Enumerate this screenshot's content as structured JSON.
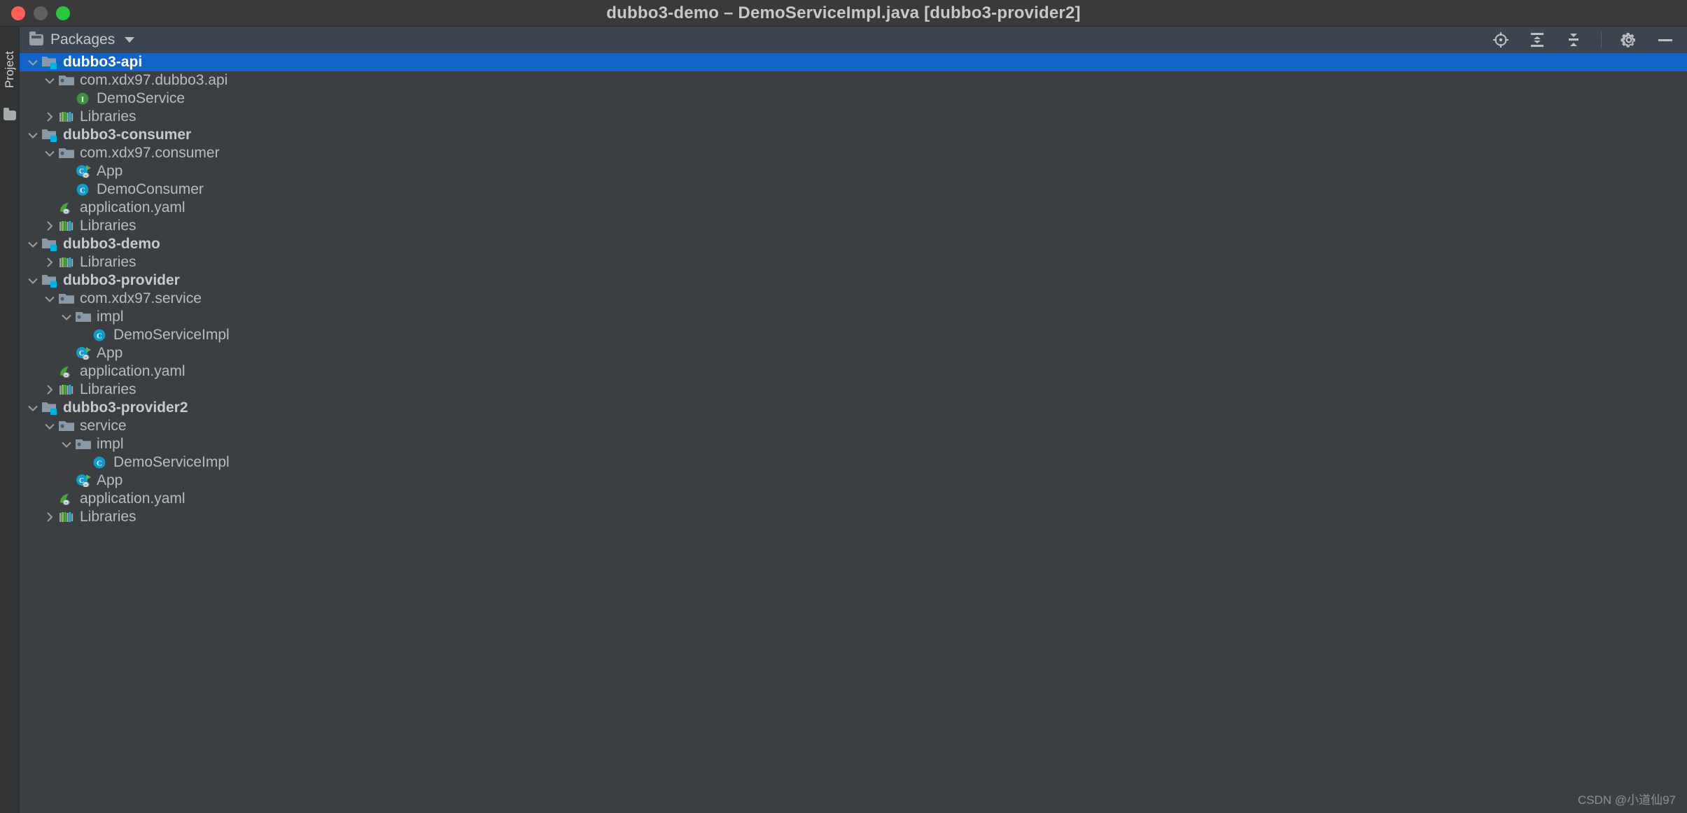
{
  "window": {
    "title": "dubbo3-demo – DemoServiceImpl.java [dubbo3-provider2]",
    "controls": {
      "close": "close-button",
      "minimize": "minimize-button",
      "zoom": "zoom-button"
    }
  },
  "rail": {
    "tab_label": "Project",
    "folder_icon": "folder-icon"
  },
  "toolwindow": {
    "title": "Packages",
    "icons": [
      "locate-icon",
      "expand-all-icon",
      "collapse-all-icon",
      "gear-icon",
      "minimize-icon"
    ]
  },
  "colors": {
    "selection": "#1264c8",
    "background": "#3c3f41",
    "header": "#3d4650",
    "titlebar": "#3a3a3a",
    "text": "#b8bcbf",
    "class_icon": "#0f9bcc",
    "interface_icon": "#3d9140",
    "spring_icon": "#4ba43a",
    "module_badge": "#00b0e0"
  },
  "watermark": "CSDN @小道仙97",
  "tree": {
    "rows": [
      {
        "indent": 0,
        "twisty": "expanded",
        "icon": "module-icon",
        "label": "dubbo3-api",
        "bold": true,
        "selected": true
      },
      {
        "indent": 1,
        "twisty": "expanded",
        "icon": "package-icon",
        "label": "com.xdx97.dubbo3.api",
        "bold": false,
        "selected": false
      },
      {
        "indent": 2,
        "twisty": "none",
        "icon": "interface-icon",
        "label": "DemoService",
        "bold": false,
        "selected": false
      },
      {
        "indent": 1,
        "twisty": "collapsed",
        "icon": "libraries-icon",
        "label": "Libraries",
        "bold": false,
        "selected": false
      },
      {
        "indent": 0,
        "twisty": "expanded",
        "icon": "module-icon",
        "label": "dubbo3-consumer",
        "bold": true,
        "selected": false
      },
      {
        "indent": 1,
        "twisty": "expanded",
        "icon": "package-icon",
        "label": "com.xdx97.consumer",
        "bold": false,
        "selected": false
      },
      {
        "indent": 2,
        "twisty": "none",
        "icon": "spring-class-icon",
        "label": "App",
        "bold": false,
        "selected": false
      },
      {
        "indent": 2,
        "twisty": "none",
        "icon": "class-icon",
        "label": "DemoConsumer",
        "bold": false,
        "selected": false
      },
      {
        "indent": 1,
        "twisty": "none",
        "icon": "spring-yaml-icon",
        "label": "application.yaml",
        "bold": false,
        "selected": false
      },
      {
        "indent": 1,
        "twisty": "collapsed",
        "icon": "libraries-icon",
        "label": "Libraries",
        "bold": false,
        "selected": false
      },
      {
        "indent": 0,
        "twisty": "expanded",
        "icon": "module-icon",
        "label": "dubbo3-demo",
        "bold": true,
        "selected": false
      },
      {
        "indent": 1,
        "twisty": "collapsed",
        "icon": "libraries-icon",
        "label": "Libraries",
        "bold": false,
        "selected": false
      },
      {
        "indent": 0,
        "twisty": "expanded",
        "icon": "module-icon",
        "label": "dubbo3-provider",
        "bold": true,
        "selected": false
      },
      {
        "indent": 1,
        "twisty": "expanded",
        "icon": "package-icon",
        "label": "com.xdx97.service",
        "bold": false,
        "selected": false
      },
      {
        "indent": 2,
        "twisty": "expanded",
        "icon": "package-icon",
        "label": "impl",
        "bold": false,
        "selected": false
      },
      {
        "indent": 3,
        "twisty": "none",
        "icon": "class-icon",
        "label": "DemoServiceImpl",
        "bold": false,
        "selected": false
      },
      {
        "indent": 2,
        "twisty": "none",
        "icon": "spring-class-icon",
        "label": "App",
        "bold": false,
        "selected": false
      },
      {
        "indent": 1,
        "twisty": "none",
        "icon": "spring-yaml-icon",
        "label": "application.yaml",
        "bold": false,
        "selected": false
      },
      {
        "indent": 1,
        "twisty": "collapsed",
        "icon": "libraries-icon",
        "label": "Libraries",
        "bold": false,
        "selected": false
      },
      {
        "indent": 0,
        "twisty": "expanded",
        "icon": "module-icon",
        "label": "dubbo3-provider2",
        "bold": true,
        "selected": false
      },
      {
        "indent": 1,
        "twisty": "expanded",
        "icon": "package-icon",
        "label": "service",
        "bold": false,
        "selected": false
      },
      {
        "indent": 2,
        "twisty": "expanded",
        "icon": "package-icon",
        "label": "impl",
        "bold": false,
        "selected": false
      },
      {
        "indent": 3,
        "twisty": "none",
        "icon": "class-icon",
        "label": "DemoServiceImpl",
        "bold": false,
        "selected": false
      },
      {
        "indent": 2,
        "twisty": "none",
        "icon": "spring-class-icon",
        "label": "App",
        "bold": false,
        "selected": false
      },
      {
        "indent": 1,
        "twisty": "none",
        "icon": "spring-yaml-icon",
        "label": "application.yaml",
        "bold": false,
        "selected": false
      },
      {
        "indent": 1,
        "twisty": "collapsed",
        "icon": "libraries-icon",
        "label": "Libraries",
        "bold": false,
        "selected": false
      }
    ]
  }
}
